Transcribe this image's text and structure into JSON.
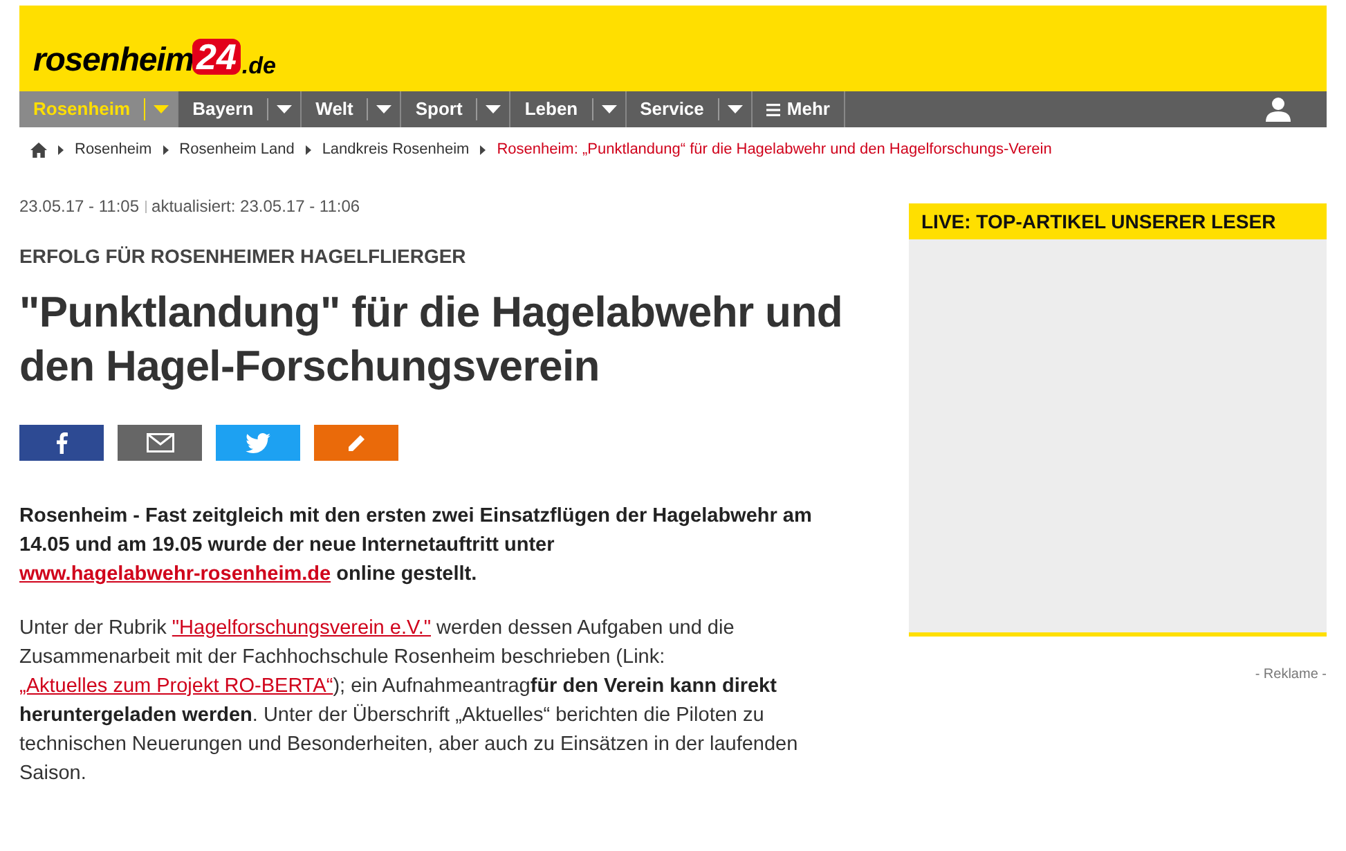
{
  "logo": {
    "name": "rosenheim",
    "number": "24",
    "suffix": ".de"
  },
  "nav": [
    {
      "label": "Rosenheim",
      "selected": true,
      "kind": "dropdown"
    },
    {
      "label": "Bayern",
      "selected": false,
      "kind": "dropdown"
    },
    {
      "label": "Welt",
      "selected": false,
      "kind": "dropdown"
    },
    {
      "label": "Sport",
      "selected": false,
      "kind": "dropdown"
    },
    {
      "label": "Leben",
      "selected": false,
      "kind": "dropdown"
    },
    {
      "label": "Service",
      "selected": false,
      "kind": "dropdown"
    },
    {
      "label": "Mehr",
      "selected": false,
      "kind": "menu"
    }
  ],
  "breadcrumb": [
    {
      "label": "Rosenheim",
      "current": false
    },
    {
      "label": "Rosenheim Land",
      "current": false
    },
    {
      "label": "Landkreis Rosenheim",
      "current": false
    },
    {
      "label": "Rosenheim: „Punktlandung“ für die Hagelabwehr und den Hagelforschungs-Verein",
      "current": true
    }
  ],
  "article": {
    "dateline": "23.05.17 - 11:05",
    "updated": "aktualisiert: 23.05.17 - 11:06",
    "kicker": "ERFOLG FÜR ROSENHEIMER HAGELFLIERGER",
    "headline": "\"Punktlandung\" für die Hagelabwehr und den Hagel-Forschungsverein",
    "share": [
      {
        "kind": "facebook"
      },
      {
        "kind": "email"
      },
      {
        "kind": "twitter"
      },
      {
        "kind": "comment"
      }
    ],
    "paragraphs": [
      {
        "kind": "lead",
        "segments": [
          {
            "kind": "text",
            "text": "Rosenheim - Fast zeitgleich mit den ersten zwei Einsatzflügen der Hagelabwehr am 14.05 und am 19.05 wurde der neue Internetauftritt unter "
          },
          {
            "kind": "link",
            "text": "www.hagelabwehr-rosenheim.de"
          },
          {
            "kind": "text",
            "text": " online gestellt."
          }
        ]
      },
      {
        "kind": "body",
        "segments": [
          {
            "kind": "text",
            "text": "Unter der Rubrik "
          },
          {
            "kind": "link",
            "text": "\"Hagelforschungsverein e.V.\""
          },
          {
            "kind": "text",
            "text": " werden dessen Aufgaben und die Zusammenarbeit mit der Fachhochschule Rosenheim beschrieben (Link: "
          },
          {
            "kind": "link",
            "text": "„Aktuelles zum Projekt RO-BERTA“"
          },
          {
            "kind": "text",
            "text": "); ein Aufnahmeantrag"
          },
          {
            "kind": "bold",
            "text": "für den Verein kann direkt heruntergeladen werden"
          },
          {
            "kind": "text",
            "text": ". Unter der Überschrift „Aktuelles“ berichten die Piloten zu technischen Neuerungen und Besonderheiten, aber auch zu Einsätzen in der laufenden Saison."
          }
        ]
      }
    ]
  },
  "sidebar": {
    "title": "LIVE: TOP-ARTIKEL UNSERER LESER",
    "ad_label": "- Reklame -"
  }
}
